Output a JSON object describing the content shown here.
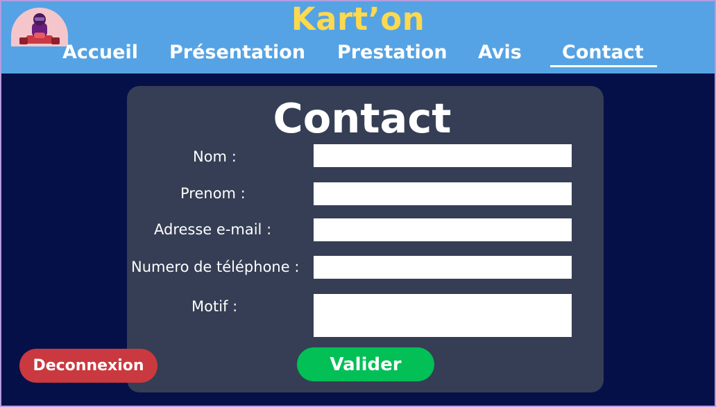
{
  "header": {
    "brand": "Kart’on",
    "logo_icon": "go-kart-driver-icon",
    "nav": [
      {
        "label": "Accueil"
      },
      {
        "label": "Présentation"
      },
      {
        "label": "Prestation"
      },
      {
        "label": "Avis"
      },
      {
        "label": "Contact",
        "active": true
      }
    ]
  },
  "form": {
    "title": "Contact",
    "fields": [
      {
        "label": "Nom :",
        "value": ""
      },
      {
        "label": "Prenom :",
        "value": ""
      },
      {
        "label": "Adresse e-mail :",
        "value": ""
      },
      {
        "label": "Numero de téléphone :",
        "value": ""
      },
      {
        "label": "Motif :",
        "value": ""
      }
    ],
    "submit_label": "Valider"
  },
  "logout_label": "Deconnexion",
  "colors": {
    "header_bg": "#55a3e4",
    "page_bg": "#061048",
    "card_bg": "#353e54",
    "brand": "#fcd94e",
    "submit": "#02bf56",
    "logout": "#c9393f"
  }
}
